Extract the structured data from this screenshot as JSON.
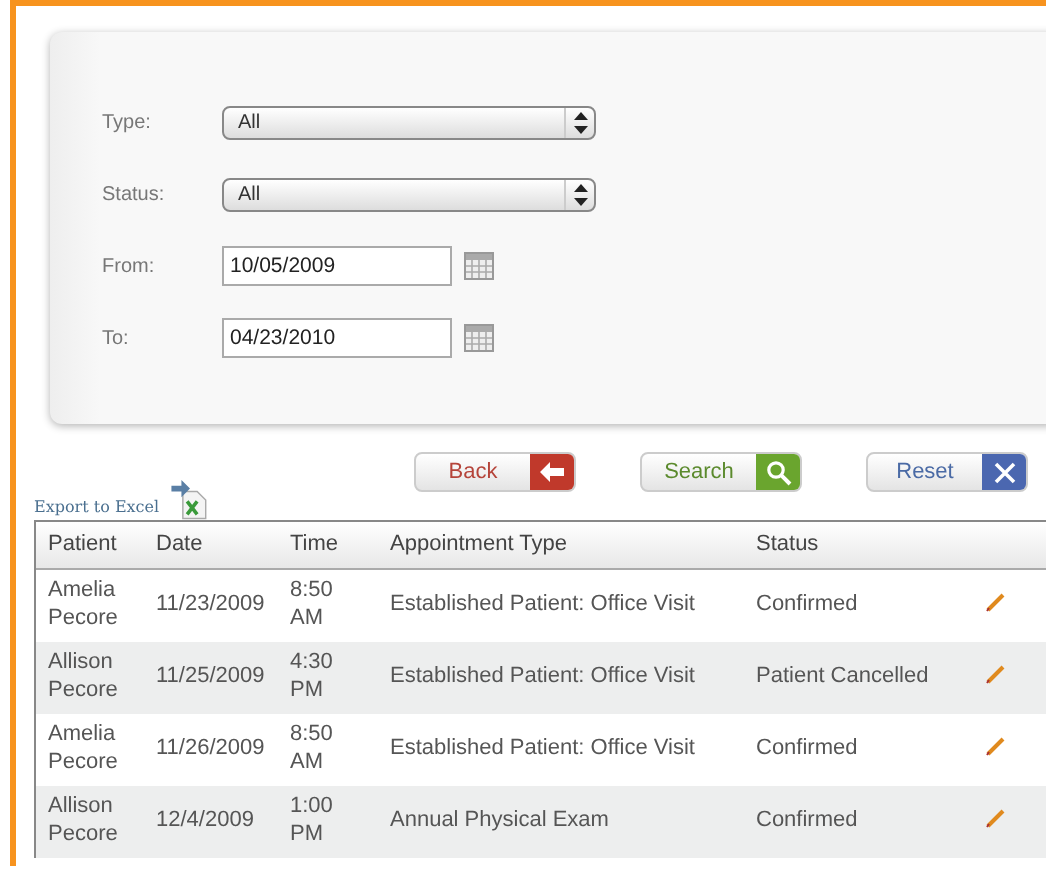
{
  "filters": [
    {
      "label": "Type:",
      "kind": "select",
      "value": "All"
    },
    {
      "label": "Status:",
      "kind": "select",
      "value": "All"
    },
    {
      "label": "From:",
      "kind": "date",
      "value": "10/05/2009"
    },
    {
      "label": "To:",
      "kind": "date",
      "value": "04/23/2010"
    }
  ],
  "buttons": [
    {
      "label": "Back",
      "kind": "back"
    },
    {
      "label": "Search",
      "kind": "search"
    },
    {
      "label": "Reset",
      "kind": "reset"
    }
  ],
  "export_link": "Export to Excel",
  "table": {
    "columns": [
      "Patient",
      "Date",
      "Time",
      "Appointment Type",
      "Status"
    ],
    "rows": [
      {
        "patient": "Amelia Pecore",
        "date": "11/23/2009",
        "time": "8:50 AM",
        "type": "Established Patient: Office Visit",
        "status": "Confirmed"
      },
      {
        "patient": "Allison Pecore",
        "date": "11/25/2009",
        "time": "4:30 PM",
        "type": "Established Patient: Office Visit",
        "status": "Patient Cancelled"
      },
      {
        "patient": "Amelia Pecore",
        "date": "11/26/2009",
        "time": "8:50 AM",
        "type": "Established Patient: Office Visit",
        "status": "Confirmed"
      },
      {
        "patient": "Allison Pecore",
        "date": "12/4/2009",
        "time": "1:00 PM",
        "type": "Annual Physical Exam",
        "status": "Confirmed"
      }
    ]
  }
}
